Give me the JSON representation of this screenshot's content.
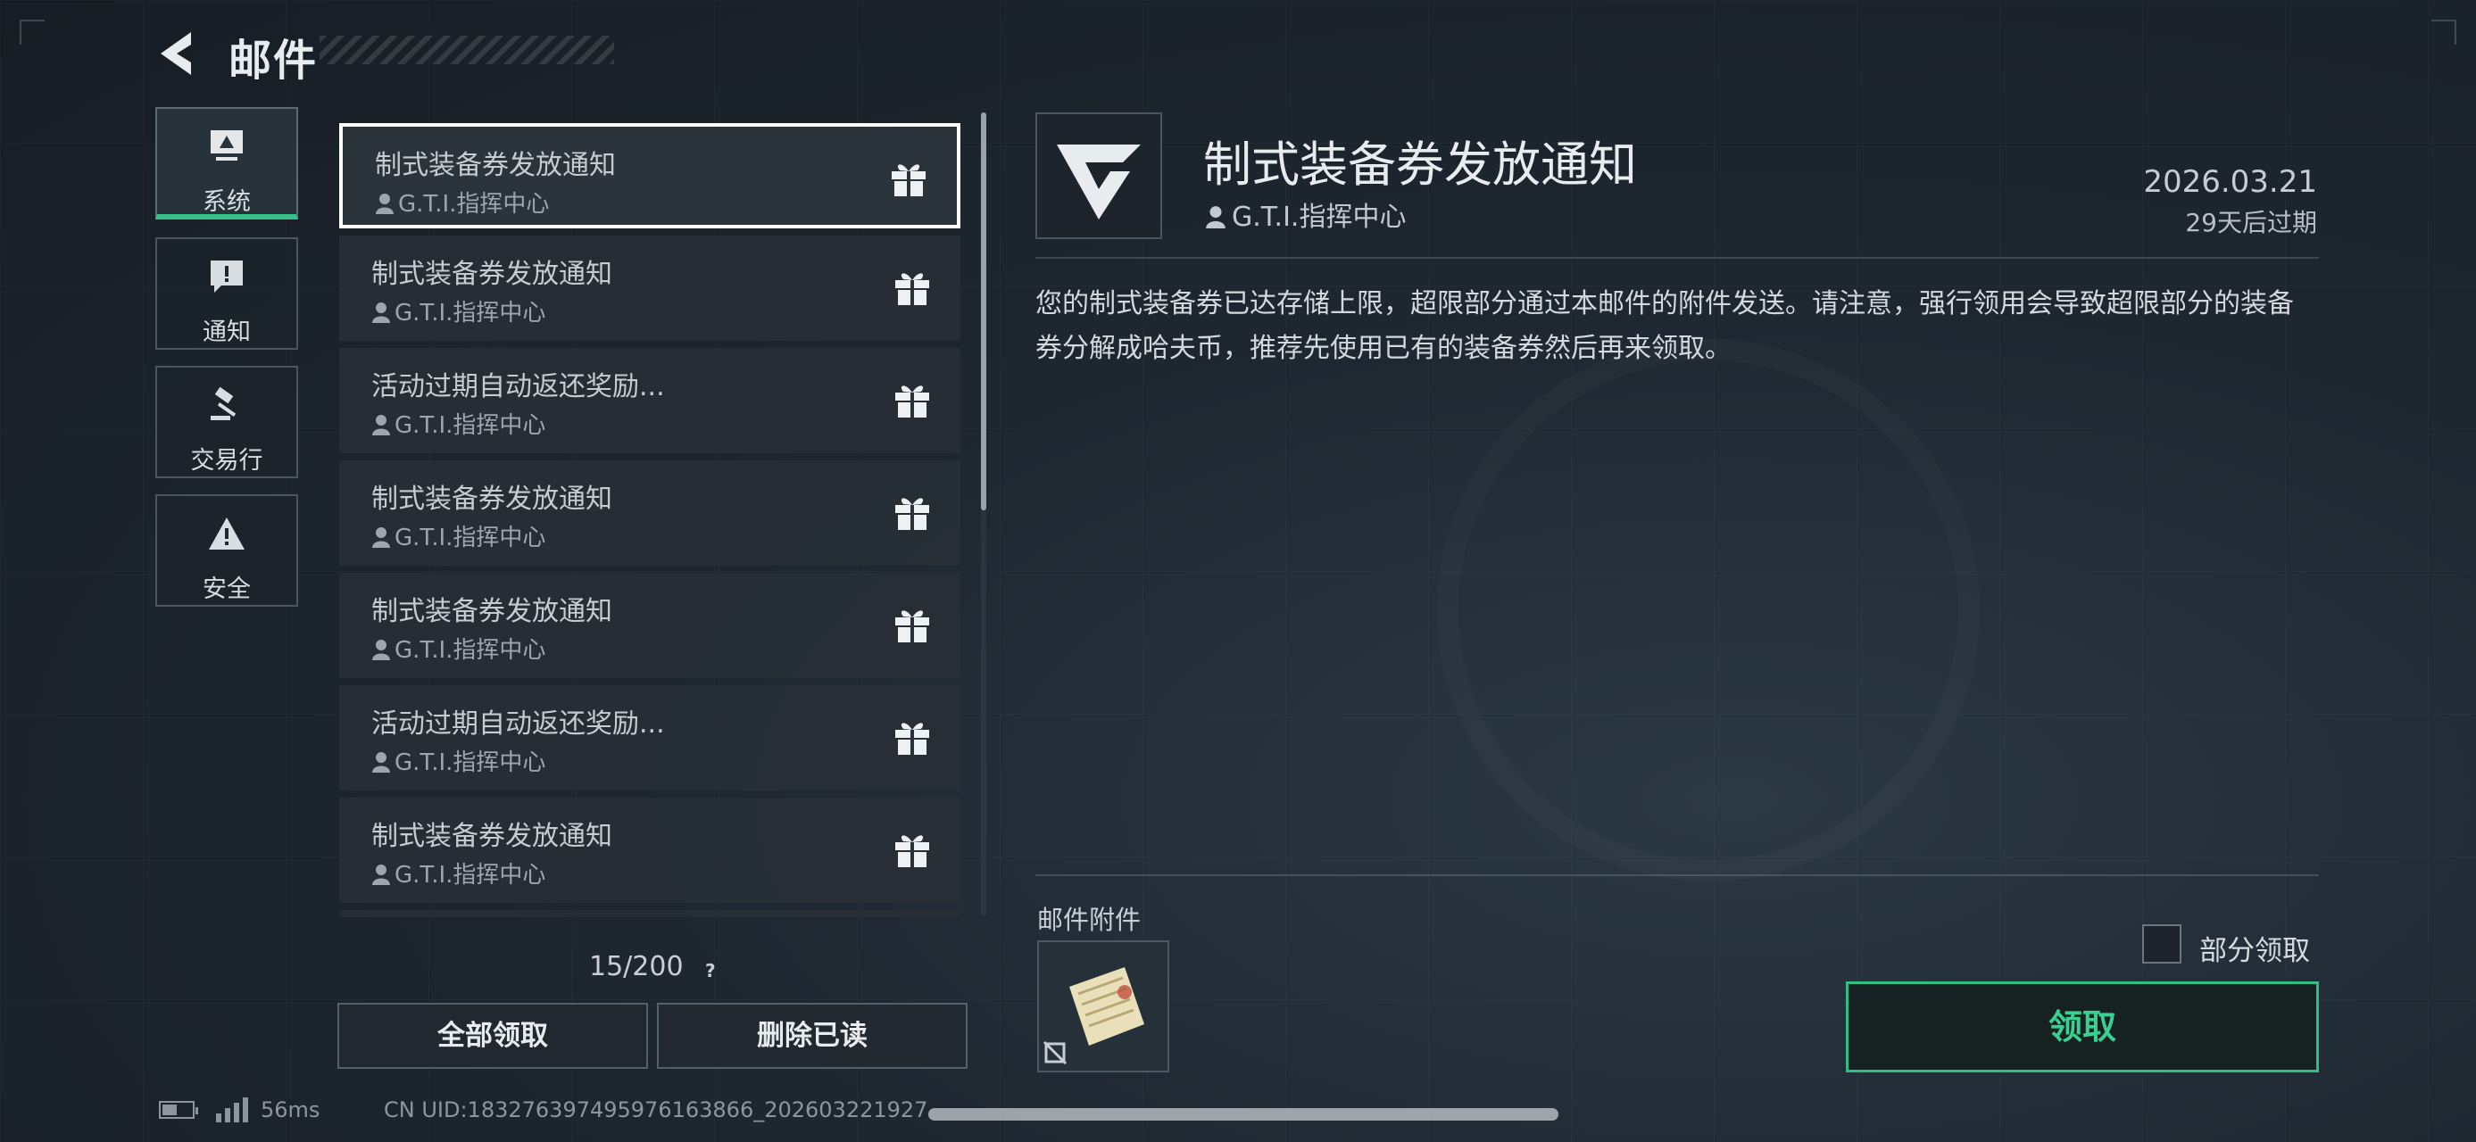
{
  "header": {
    "title": "邮件"
  },
  "categories": [
    {
      "label": "系统",
      "icon": "monitor-icon",
      "active": true
    },
    {
      "label": "通知",
      "icon": "exclamation-bubble-icon",
      "active": false
    },
    {
      "label": "交易行",
      "icon": "gavel-icon",
      "active": false
    },
    {
      "label": "安全",
      "icon": "warning-triangle-icon",
      "active": false
    }
  ],
  "mail_list": [
    {
      "title": "制式装备券发放通知",
      "sender": "G.T.I.指挥中心",
      "icon": "gift-icon"
    },
    {
      "title": "制式装备券发放通知",
      "sender": "G.T.I.指挥中心",
      "icon": "gift-icon"
    },
    {
      "title": "活动过期自动返还奖励...",
      "sender": "G.T.I.指挥中心",
      "icon": "gift-icon"
    },
    {
      "title": "制式装备券发放通知",
      "sender": "G.T.I.指挥中心",
      "icon": "gift-icon"
    },
    {
      "title": "制式装备券发放通知",
      "sender": "G.T.I.指挥中心",
      "icon": "gift-icon"
    },
    {
      "title": "活动过期自动返还奖励...",
      "sender": "G.T.I.指挥中心",
      "icon": "gift-icon"
    },
    {
      "title": "制式装备券发放通知",
      "sender": "G.T.I.指挥中心",
      "icon": "gift-icon"
    }
  ],
  "list_footer": {
    "counter": "15/200",
    "help": "?",
    "claim_all": "全部领取",
    "delete_read": "删除已读"
  },
  "detail": {
    "title": "制式装备券发放通知",
    "sender": "G.T.I.指挥中心",
    "date": "2026.03.21",
    "expire": "29天后过期",
    "body": "您的制式装备券已达存储上限，超限部分通过本邮件的附件发送。请注意，强行领用会导致超限部分的装备券分解成哈夫币，推荐先使用已有的装备券然后再来领取。",
    "attachments_label": "邮件附件",
    "partial_claim_label": "部分领取",
    "claim_label": "领取"
  },
  "status_bar": {
    "latency": "56ms",
    "uid": "CN UID:1832763974959761638​66_202603221927"
  },
  "colors": {
    "accent": "#36c08a",
    "claim_text": "#39d091"
  }
}
